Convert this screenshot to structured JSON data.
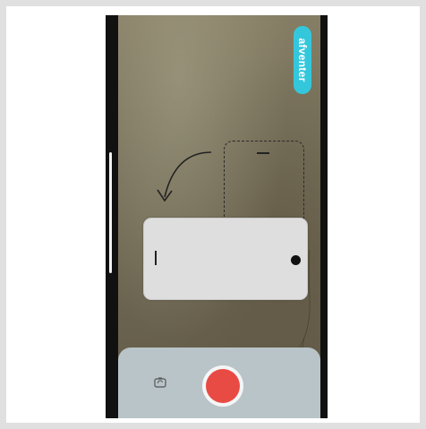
{
  "top_pill": {
    "label": "afventer"
  },
  "colors": {
    "accent": "#34c7dc",
    "record": "#e84b43",
    "panel": "#b9c4c8"
  },
  "icons": [
    "rotate-arrow-icon",
    "camera-flip-icon",
    "record-button"
  ]
}
